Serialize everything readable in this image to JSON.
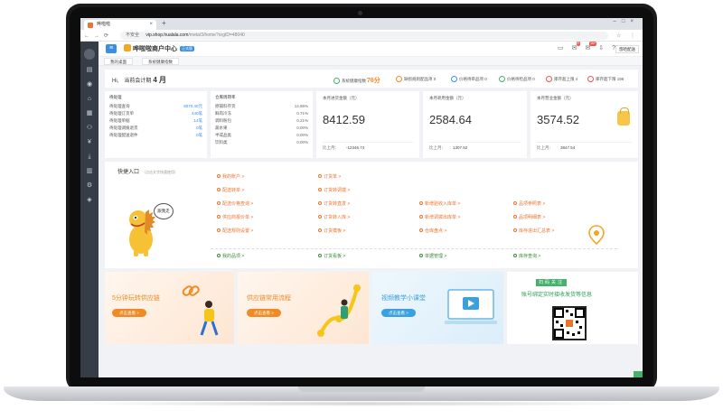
{
  "browser": {
    "tab_title": "哗啦啦",
    "address_secure": "不安全",
    "address_host": "vip.shop.hualala.com",
    "address_path": "/meta/3/home?orgID=48040"
  },
  "app": {
    "brand": "哗啦啦商户中心",
    "brand_tag": "正式版",
    "menu_icon": "menu-icon",
    "notifications": [
      "8",
      "99+"
    ],
    "user": "悠哈配送",
    "page_tabs": [
      "我的桌面",
      "系统健康指数"
    ]
  },
  "header": {
    "greeting": "Hi,",
    "accounting_label": "当前会计期",
    "accounting_period": "4 月",
    "stats": [
      {
        "label": "系统健康指数",
        "value": "76分",
        "color": "#42b36b"
      },
      {
        "label": "缺损规则配品项",
        "value": "0",
        "color": "#f08a24"
      },
      {
        "label": "价格待审品项",
        "value": "0",
        "color": "#3a8ee6"
      },
      {
        "label": "价格待检品项",
        "value": "0",
        "color": "#42b36b"
      },
      {
        "label": "库存超上限",
        "value": "4",
        "color": "#f25353"
      },
      {
        "label": "库存超下限",
        "value": "196",
        "color": "#f25353"
      }
    ]
  },
  "todo": {
    "title": "待处理",
    "rows": [
      {
        "label": "待处理查询",
        "value": "8070.40元"
      },
      {
        "label": "待处理订货单",
        "value": "440笔"
      },
      {
        "label": "待处理单据",
        "value": "14笔"
      },
      {
        "label": "待处理调拨退货",
        "value": "0笔"
      },
      {
        "label": "待处理配送退件",
        "value": "0笔"
      }
    ]
  },
  "inventory": {
    "title": "仓库周转率",
    "rows": [
      {
        "label": "原辅料存货",
        "value": "14.86%"
      },
      {
        "label": "鲜肉冷冻",
        "value": "0.71%"
      },
      {
        "label": "调料粉包",
        "value": "0.21%"
      },
      {
        "label": "蔬水果",
        "value": "0.00%"
      },
      {
        "label": "半成品类",
        "value": "0.00%"
      },
      {
        "label": "饮料类",
        "value": "0.00%"
      }
    ]
  },
  "metrics": [
    {
      "title": "本月进货金额（元）",
      "value": "8412.59",
      "footer_label": "比上月：",
      "footer_value": "-12346.74"
    },
    {
      "title": "本月耗用金额（元）",
      "value": "2584.64",
      "footer_label": "比上月：",
      "footer_value": "1307.52"
    },
    {
      "title": "本月营业金额（元）",
      "value": "3574.52",
      "footer_label": "比上月：",
      "footer_value": "3847.54"
    }
  ],
  "quick": {
    "title": "快捷入口",
    "subtitle": "（点击文字快速使用）",
    "bubble": "跟我走",
    "col1": [
      "我的账户 >",
      "配送转单 >",
      "配送价格查询 >",
      "供应商报价单 >",
      "配送规则设置 >"
    ],
    "col2": [
      "订货单 >",
      "订货转调拨 >",
      "订货转直发 >",
      "订货转入库 >",
      "订货模板 >"
    ],
    "col3": [
      "新增验收入库单 >",
      "新增调拨出库单 >",
      "仓库盘点 >"
    ],
    "col4": [
      "品项参照表 >",
      "品项明细表 >",
      "库存进出汇总表 >"
    ],
    "bottom": [
      "我的品项 >",
      "订货看板 >",
      "单据管理 >",
      "库存查询 >"
    ]
  },
  "banners": [
    {
      "title": "5分钟玩转供应链",
      "button": "点击查看 >",
      "color": "#f08a24"
    },
    {
      "title": "供应链常用流程",
      "button": "点击查看 >",
      "color": "#f08a24"
    },
    {
      "title": "视频教学小课堂",
      "button": "点击查看 >",
      "color": "#3aa0e0"
    },
    {
      "title": "账号绑定实时接收发货等信息",
      "button": "",
      "color": "#42b36b",
      "kicker": "扫码关注"
    }
  ],
  "help_button": "客服"
}
